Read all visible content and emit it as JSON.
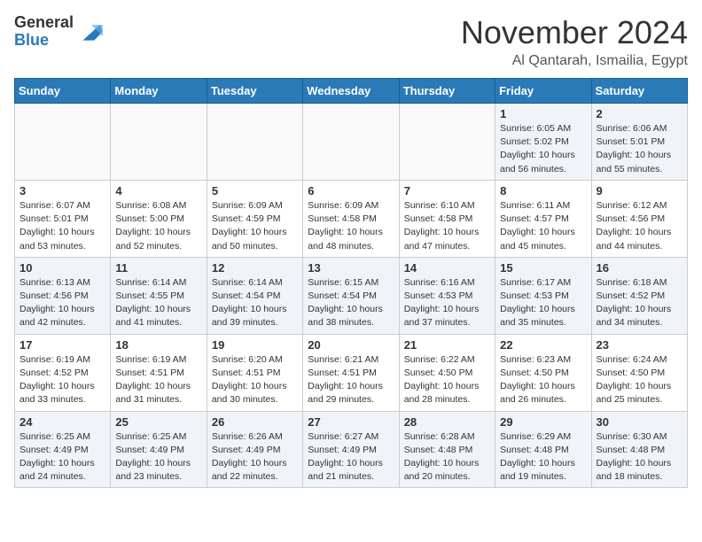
{
  "logo": {
    "general": "General",
    "blue": "Blue"
  },
  "header": {
    "month": "November 2024",
    "location": "Al Qantarah, Ismailia, Egypt"
  },
  "weekdays": [
    "Sunday",
    "Monday",
    "Tuesday",
    "Wednesday",
    "Thursday",
    "Friday",
    "Saturday"
  ],
  "weeks": [
    [
      {
        "day": "",
        "info": ""
      },
      {
        "day": "",
        "info": ""
      },
      {
        "day": "",
        "info": ""
      },
      {
        "day": "",
        "info": ""
      },
      {
        "day": "",
        "info": ""
      },
      {
        "day": "1",
        "info": "Sunrise: 6:05 AM\nSunset: 5:02 PM\nDaylight: 10 hours and 56 minutes."
      },
      {
        "day": "2",
        "info": "Sunrise: 6:06 AM\nSunset: 5:01 PM\nDaylight: 10 hours and 55 minutes."
      }
    ],
    [
      {
        "day": "3",
        "info": "Sunrise: 6:07 AM\nSunset: 5:01 PM\nDaylight: 10 hours and 53 minutes."
      },
      {
        "day": "4",
        "info": "Sunrise: 6:08 AM\nSunset: 5:00 PM\nDaylight: 10 hours and 52 minutes."
      },
      {
        "day": "5",
        "info": "Sunrise: 6:09 AM\nSunset: 4:59 PM\nDaylight: 10 hours and 50 minutes."
      },
      {
        "day": "6",
        "info": "Sunrise: 6:09 AM\nSunset: 4:58 PM\nDaylight: 10 hours and 48 minutes."
      },
      {
        "day": "7",
        "info": "Sunrise: 6:10 AM\nSunset: 4:58 PM\nDaylight: 10 hours and 47 minutes."
      },
      {
        "day": "8",
        "info": "Sunrise: 6:11 AM\nSunset: 4:57 PM\nDaylight: 10 hours and 45 minutes."
      },
      {
        "day": "9",
        "info": "Sunrise: 6:12 AM\nSunset: 4:56 PM\nDaylight: 10 hours and 44 minutes."
      }
    ],
    [
      {
        "day": "10",
        "info": "Sunrise: 6:13 AM\nSunset: 4:56 PM\nDaylight: 10 hours and 42 minutes."
      },
      {
        "day": "11",
        "info": "Sunrise: 6:14 AM\nSunset: 4:55 PM\nDaylight: 10 hours and 41 minutes."
      },
      {
        "day": "12",
        "info": "Sunrise: 6:14 AM\nSunset: 4:54 PM\nDaylight: 10 hours and 39 minutes."
      },
      {
        "day": "13",
        "info": "Sunrise: 6:15 AM\nSunset: 4:54 PM\nDaylight: 10 hours and 38 minutes."
      },
      {
        "day": "14",
        "info": "Sunrise: 6:16 AM\nSunset: 4:53 PM\nDaylight: 10 hours and 37 minutes."
      },
      {
        "day": "15",
        "info": "Sunrise: 6:17 AM\nSunset: 4:53 PM\nDaylight: 10 hours and 35 minutes."
      },
      {
        "day": "16",
        "info": "Sunrise: 6:18 AM\nSunset: 4:52 PM\nDaylight: 10 hours and 34 minutes."
      }
    ],
    [
      {
        "day": "17",
        "info": "Sunrise: 6:19 AM\nSunset: 4:52 PM\nDaylight: 10 hours and 33 minutes."
      },
      {
        "day": "18",
        "info": "Sunrise: 6:19 AM\nSunset: 4:51 PM\nDaylight: 10 hours and 31 minutes."
      },
      {
        "day": "19",
        "info": "Sunrise: 6:20 AM\nSunset: 4:51 PM\nDaylight: 10 hours and 30 minutes."
      },
      {
        "day": "20",
        "info": "Sunrise: 6:21 AM\nSunset: 4:51 PM\nDaylight: 10 hours and 29 minutes."
      },
      {
        "day": "21",
        "info": "Sunrise: 6:22 AM\nSunset: 4:50 PM\nDaylight: 10 hours and 28 minutes."
      },
      {
        "day": "22",
        "info": "Sunrise: 6:23 AM\nSunset: 4:50 PM\nDaylight: 10 hours and 26 minutes."
      },
      {
        "day": "23",
        "info": "Sunrise: 6:24 AM\nSunset: 4:50 PM\nDaylight: 10 hours and 25 minutes."
      }
    ],
    [
      {
        "day": "24",
        "info": "Sunrise: 6:25 AM\nSunset: 4:49 PM\nDaylight: 10 hours and 24 minutes."
      },
      {
        "day": "25",
        "info": "Sunrise: 6:25 AM\nSunset: 4:49 PM\nDaylight: 10 hours and 23 minutes."
      },
      {
        "day": "26",
        "info": "Sunrise: 6:26 AM\nSunset: 4:49 PM\nDaylight: 10 hours and 22 minutes."
      },
      {
        "day": "27",
        "info": "Sunrise: 6:27 AM\nSunset: 4:49 PM\nDaylight: 10 hours and 21 minutes."
      },
      {
        "day": "28",
        "info": "Sunrise: 6:28 AM\nSunset: 4:48 PM\nDaylight: 10 hours and 20 minutes."
      },
      {
        "day": "29",
        "info": "Sunrise: 6:29 AM\nSunset: 4:48 PM\nDaylight: 10 hours and 19 minutes."
      },
      {
        "day": "30",
        "info": "Sunrise: 6:30 AM\nSunset: 4:48 PM\nDaylight: 10 hours and 18 minutes."
      }
    ]
  ]
}
